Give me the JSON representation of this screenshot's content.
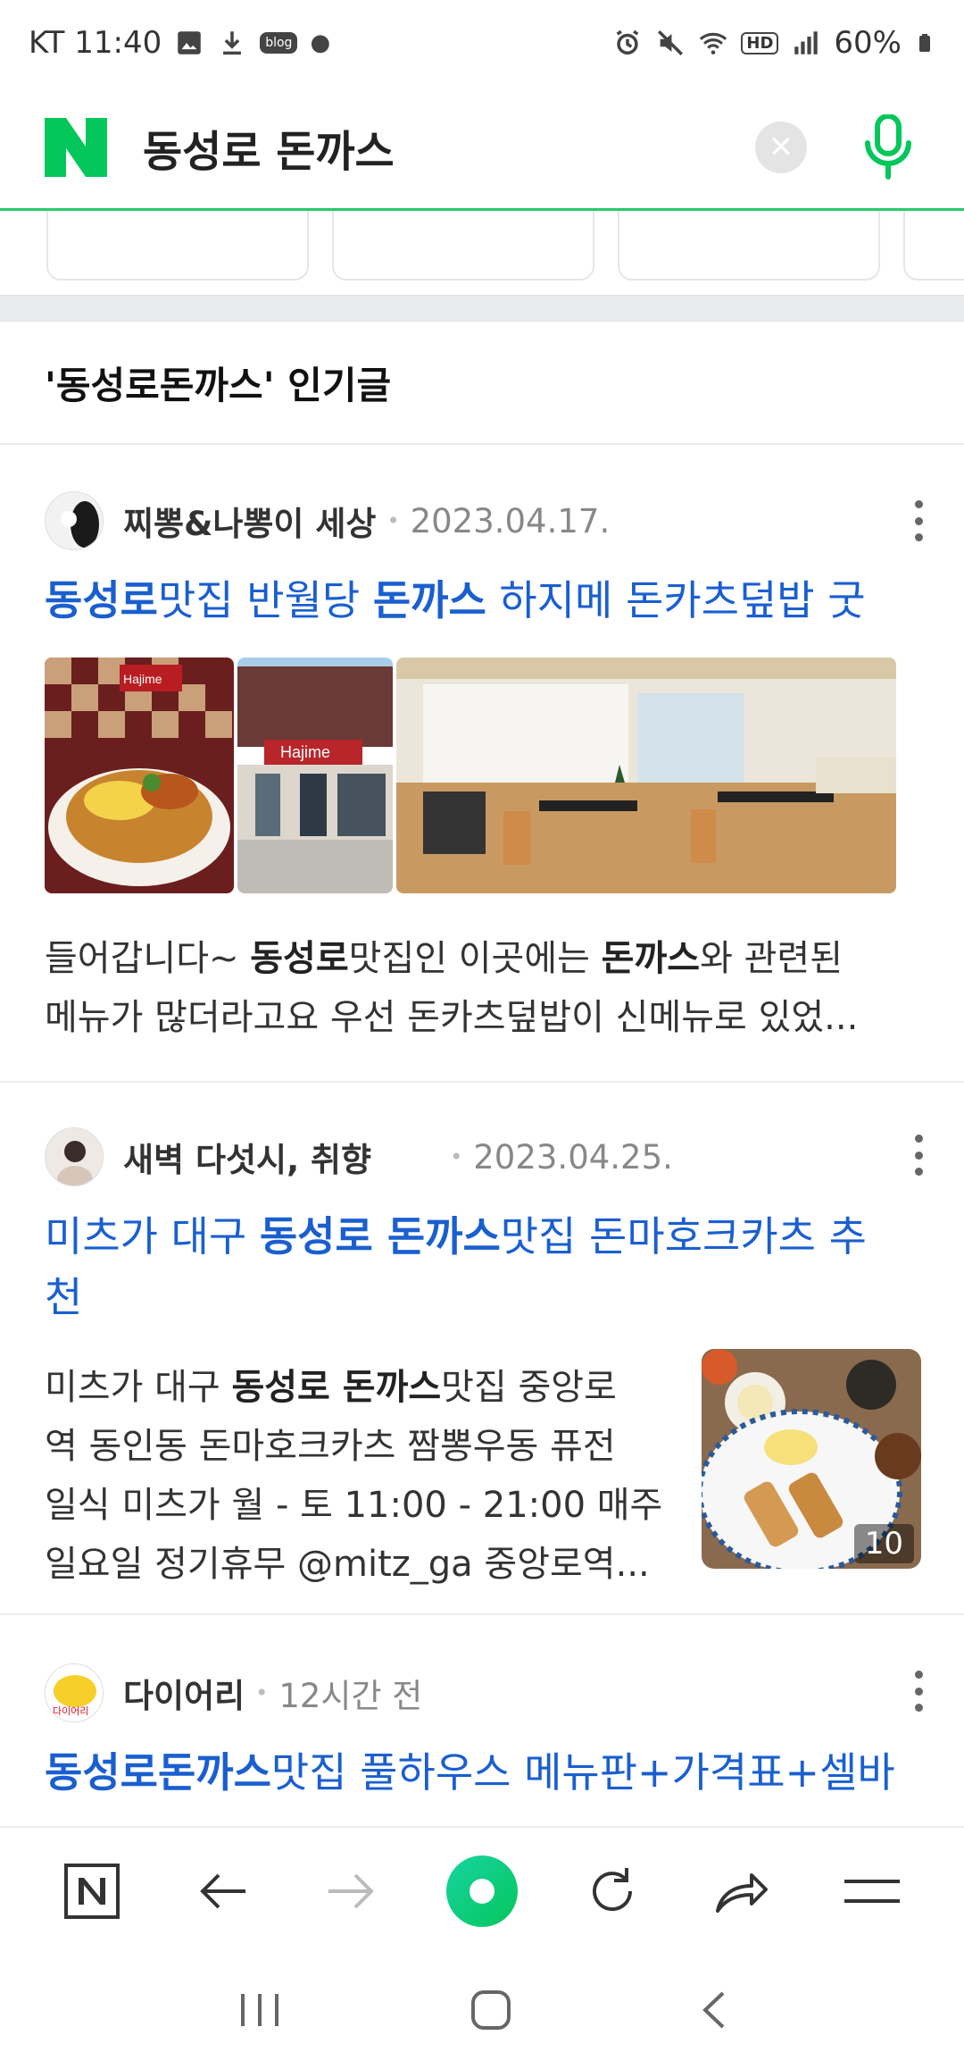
{
  "status_bar": {
    "carrier_time": "KT 11:40",
    "battery": "60%",
    "hd_label": "HD",
    "blog_label": "blog"
  },
  "search": {
    "logo": "N",
    "query": "동성로 돈까스"
  },
  "section": {
    "title": "'동성로돈까스' 인기글"
  },
  "posts": [
    {
      "author": "찌뽕&나뽕이 세상",
      "date": "2023.04.17.",
      "title_parts": [
        "동성로",
        "맛집 반월당 ",
        "돈까스",
        " 하지메 돈카츠덮밥 굿"
      ],
      "image_sign": "Hajime",
      "snippet_line1_parts": [
        "들어갑니다~ ",
        "동성로",
        "맛집인 이곳에는 ",
        "돈까스",
        "와 관련된"
      ],
      "snippet_line2": "메뉴가 많더라고요 우선 돈카츠덮밥이 신메뉴로 있었..."
    },
    {
      "author": "새벽 다섯시, 취향",
      "date": "2023.04.25.",
      "title_parts": [
        "미츠가 대구 ",
        "동성로 돈까스",
        "맛집 돈마호크카츠 추"
      ],
      "title_line2": "천",
      "snippet_line1_parts": [
        "미츠가 대구 ",
        "동성로 돈까스",
        "맛집 중앙로"
      ],
      "snippet_line2": "역 동인동 돈마호크카츠 짬뽕우동 퓨전",
      "snippet_line3": "일식 미츠가 월 - 토 11:00 - 21:00 매주",
      "snippet_line4": "일요일 정기휴무 @mitz_ga 중앙로역...",
      "image_count": "10"
    },
    {
      "author": "다이어리",
      "avatar_text": "다이어리",
      "date": "12시간 전",
      "title_parts": [
        "동성로돈까스",
        "맛집 풀하우스 메뉴판+가격표+셀바"
      ]
    }
  ],
  "colors": {
    "accent_green": "#03c75a",
    "link_blue": "#1a5fd0"
  }
}
